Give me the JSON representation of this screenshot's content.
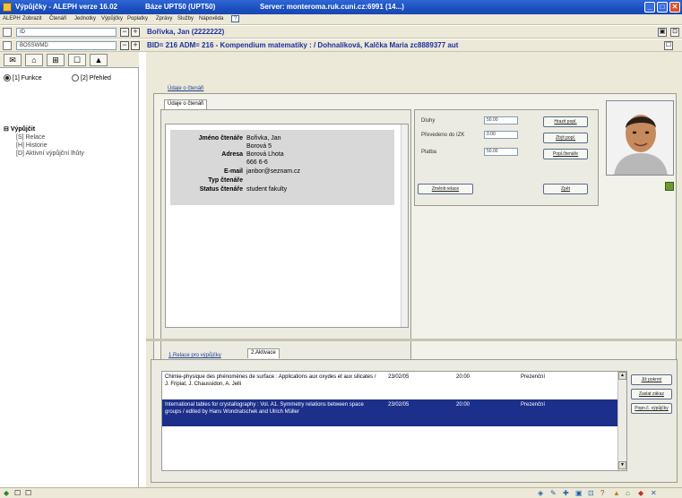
{
  "window": {
    "title": "Výpůjčky - ALEPH verze 16.02",
    "base": "Báze UPT50 (UPT50)",
    "server": "Server:  monteroma.ruk.cuni.cz:6991 (14...)",
    "buttons": {
      "minimize": "_",
      "maximize": "□",
      "close": "✕"
    }
  },
  "menu": [
    "ALEPH",
    "Zobrazit",
    "Čtenáři",
    "Jednotky",
    "Výpůjčky",
    "Poplatky",
    "Zprávy",
    "Služby",
    "Nápověda"
  ],
  "menu_help": "?",
  "row1": {
    "combo": "ID",
    "header": "Bořivka, Jan (2222222)"
  },
  "row2": {
    "combo": "BOSSWMD",
    "header": "BID= 216 ADM= 216 - Kompendium matematiky : / Dohnalíková, Kalčka Maria zc8889377 aut"
  },
  "left": {
    "tabs": [
      "✉",
      "⌂",
      "⊞",
      "☐",
      "▲"
    ],
    "radio1": "[1] Funkce",
    "radio2": "[2] Přehled",
    "tree_root": "Výpůjčit",
    "tree_children": [
      "[S] Relace",
      "[H] Historie",
      "[D] Aktivní výpůjční lhůty"
    ]
  },
  "patron_tab": {
    "outer": "Údaje o čtenáři",
    "inner": "Údaje o čtenáři"
  },
  "patron": {
    "name_label": "Jméno čtenáře",
    "name_value": "Bořivka, Jan",
    "addr1": "Borová 5",
    "addr2": "Borová Lhota",
    "addr3": "666 6-6",
    "addr_label": "Adresa",
    "email_label": "E-mail",
    "email_value": "janbor@seznam.cz",
    "type_label": "Typ čtenáře",
    "type_value": "",
    "status_label": "Status čtenáře",
    "status_value": "student fakulty"
  },
  "finance": {
    "dluh_label": "Dluhy",
    "dluh_value": "50.00",
    "prevod_label": "Převedeno do IZK",
    "prevod_value": "0.00",
    "platba_label": "Platba",
    "platba_value": "50.00",
    "btn_pay": "Hrazit popl.",
    "btn_waive": "Zbýt popl.",
    "btn_reader": "Popl.čtenáře",
    "btn_relation": "Změnit relace",
    "btn_back": "Zpět"
  },
  "loans_tabs": {
    "tab1": "1.Relace pro výpůjčky",
    "tab2": "2.Aktivace"
  },
  "loans": [
    {
      "title": "Chimie-physique des phénomènes de surface : Applications aux oxydes et aux silicates / J. Fripiat, J. Chaussidon, A. Jelli",
      "date": "23/02/05",
      "time": "20:00",
      "status": "Prezenční"
    },
    {
      "title": "International tables for crystallography : Vol. A1. Symmetry relations between space groups / edited by Hans Wondratschek and Ulrich Müller",
      "date": "23/02/05",
      "time": "20:00",
      "status": "Prezenční"
    }
  ],
  "loan_buttons": [
    "Již pokrmí",
    "Zaslat zákaz",
    "Popn.č. výpůjčky"
  ],
  "statusbar": {
    "left_icons": [
      "◆",
      "☐",
      "☐"
    ],
    "right_icons": [
      "◈",
      "✎",
      "✚",
      "▣",
      "⊡",
      "?",
      "▲",
      "⌂",
      "◆",
      "✕"
    ]
  }
}
